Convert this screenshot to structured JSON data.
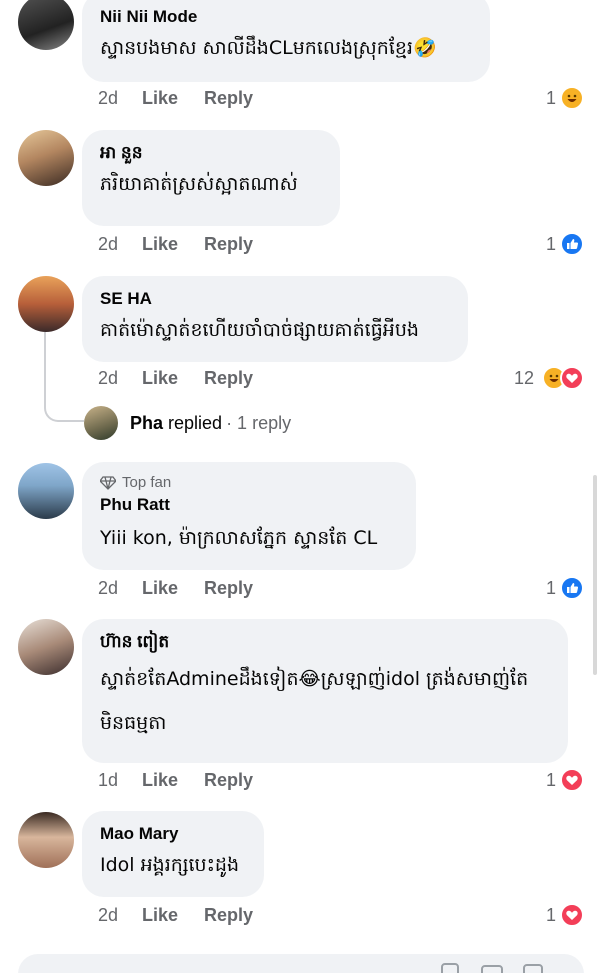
{
  "comments": [
    {
      "author": "Nii Nii Mode",
      "text": "ស្ទានបងមាស សាលីដឹងCLមកលេងស្រុកខ្មែរ🤣",
      "time": "2d",
      "like": "Like",
      "reply": "Reply",
      "reaction_count": "1",
      "reactions": [
        "haha"
      ]
    },
    {
      "author": "អា នួន",
      "text": "ភរិយាគាត់ស្រស់ស្អាតណាស់",
      "time": "2d",
      "like": "Like",
      "reply": "Reply",
      "reaction_count": "1",
      "reactions": [
        "like"
      ]
    },
    {
      "author": "SE HA",
      "text": "គាត់ម៉ោស្ទាត់ខហើយចាំបាច់ផ្សាយគាត់ធ្វើអីបង",
      "time": "2d",
      "like": "Like",
      "reply": "Reply",
      "reaction_count": "12",
      "reactions": [
        "haha",
        "love"
      ],
      "replies": {
        "name": "Pha",
        "word": "replied",
        "count": "· 1 reply"
      }
    },
    {
      "badge": "Top fan",
      "author": "Phu Ratt",
      "text": "Yiii kon, ម៉ាក្រលាសភ្នែក ស្ទានតែ CL",
      "time": "2d",
      "like": "Like",
      "reply": "Reply",
      "reaction_count": "1",
      "reactions": [
        "like"
      ]
    },
    {
      "author": "ហ៊ាន ពៀត",
      "text": "ស្ទាត់ខតែAdmineដឹងទៀត😂ស្រឡាញ់idol ត្រង់សមាញ់តែមិនធម្មតា",
      "time": "1d",
      "like": "Like",
      "reply": "Reply",
      "reaction_count": "1",
      "reactions": [
        "love"
      ]
    },
    {
      "author": "Mao Mary",
      "text": "Idol អង្គរក្សបេះដូង",
      "time": "2d",
      "like": "Like",
      "reply": "Reply",
      "reaction_count": "1",
      "reactions": [
        "love"
      ]
    }
  ],
  "icons": {
    "like": "thumbs-up-icon",
    "love": "heart-icon",
    "haha": "laughing-face-icon",
    "top_fan": "diamond-icon"
  },
  "colors": {
    "like": "#1877f2",
    "love": "#f33e58",
    "haha": "#f7b125",
    "bubble": "#f0f2f5",
    "meta": "#65676b"
  }
}
